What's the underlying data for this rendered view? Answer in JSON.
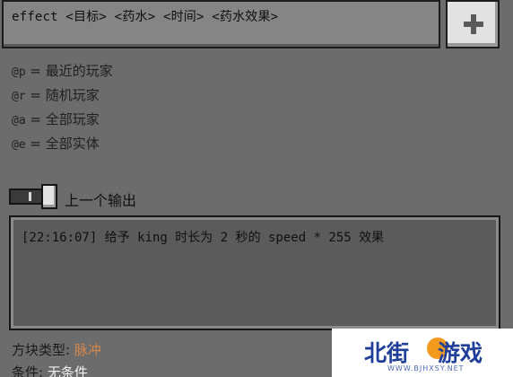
{
  "command_input": {
    "value": "effect <目标> <药水> <时间> <药水效果>"
  },
  "add_button": {
    "icon": "plus-icon"
  },
  "selectors": [
    {
      "code": "@p",
      "sep": " = ",
      "label": "最近的玩家"
    },
    {
      "code": "@r",
      "sep": " = ",
      "label": "随机玩家"
    },
    {
      "code": "@a",
      "sep": " = ",
      "label": "全部玩家"
    },
    {
      "code": "@e",
      "sep": " = ",
      "label": "全部实体"
    }
  ],
  "previous_output_toggle": {
    "label": "上一个输出",
    "state": "on"
  },
  "output": {
    "text": "[22:16:07] 给予 king 时长为 2 秒的 speed * 255 效果"
  },
  "block_type": {
    "label": "方块类型: ",
    "value": "脉冲"
  },
  "condition": {
    "label": "条件: ",
    "value": "无条件"
  },
  "watermark": {
    "part1": "北街",
    "part2": "游戏",
    "url": "WWW.BJHXSY.NET"
  },
  "colors": {
    "background": "#6c6c6c",
    "block_type_value": "#d7874a",
    "watermark_blue": "#1f3f9a",
    "watermark_orange": "#f29a1e"
  }
}
